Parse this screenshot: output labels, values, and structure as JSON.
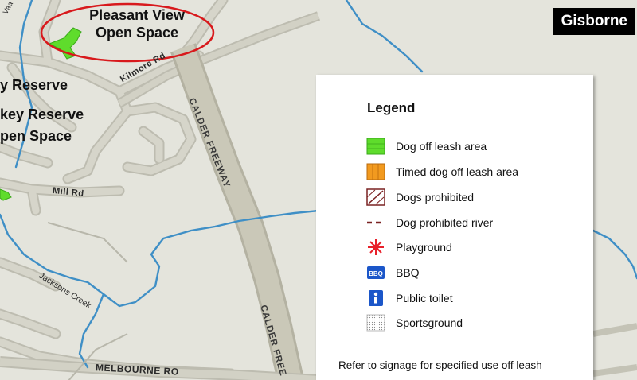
{
  "map": {
    "town_title": "Gisborne",
    "park_labels": {
      "pleasant_view_line1": "Pleasant View",
      "pleasant_view_line2": "Open Space",
      "reserve_a": "y Reserve",
      "reserve_b": "key Reserve",
      "reserve_c": "pen Space"
    },
    "roads": {
      "kilmore": "Kilmore Rd",
      "mill": "Mill Rd",
      "calder_upper": "CALDER FREEWAY",
      "calder_lower": "CALDER FREE",
      "melbourne": "MELBOURNE RO",
      "top_left": "Vaa Creek"
    },
    "creek": "Jacksons Creek",
    "colors": {
      "background": "#e4e4dc",
      "road_fill": "#cbcabd",
      "road_edge": "#b9b8aa",
      "freeway": "#c9c7b6",
      "creek": "#3f8fc6",
      "dog_off_leash": "#5fdc2c",
      "timed_off_leash": "#f29a1f",
      "prohibited": "#7a2222",
      "playground": "#e8202a",
      "bbq": "#1b56c9",
      "toilet": "#1b56c9",
      "highlight_circle": "#d8191c"
    }
  },
  "legend": {
    "title": "Legend",
    "items": [
      {
        "label": "Dog off leash area",
        "icon": "dog-off-leash-swatch-icon"
      },
      {
        "label": "Timed dog off leash area",
        "icon": "timed-off-leash-swatch-icon"
      },
      {
        "label": "Dogs prohibited",
        "icon": "dogs-prohibited-swatch-icon"
      },
      {
        "label": "Dog prohibited river",
        "icon": "dog-prohibited-river-icon"
      },
      {
        "label": "Playground",
        "icon": "playground-icon"
      },
      {
        "label": "BBQ",
        "icon": "bbq-icon",
        "icon_text": "BBQ"
      },
      {
        "label": "Public toilet",
        "icon": "public-toilet-icon"
      },
      {
        "label": "Sportsground",
        "icon": "sportsground-swatch-icon"
      }
    ],
    "note": "Refer to signage for specified use off leash"
  }
}
